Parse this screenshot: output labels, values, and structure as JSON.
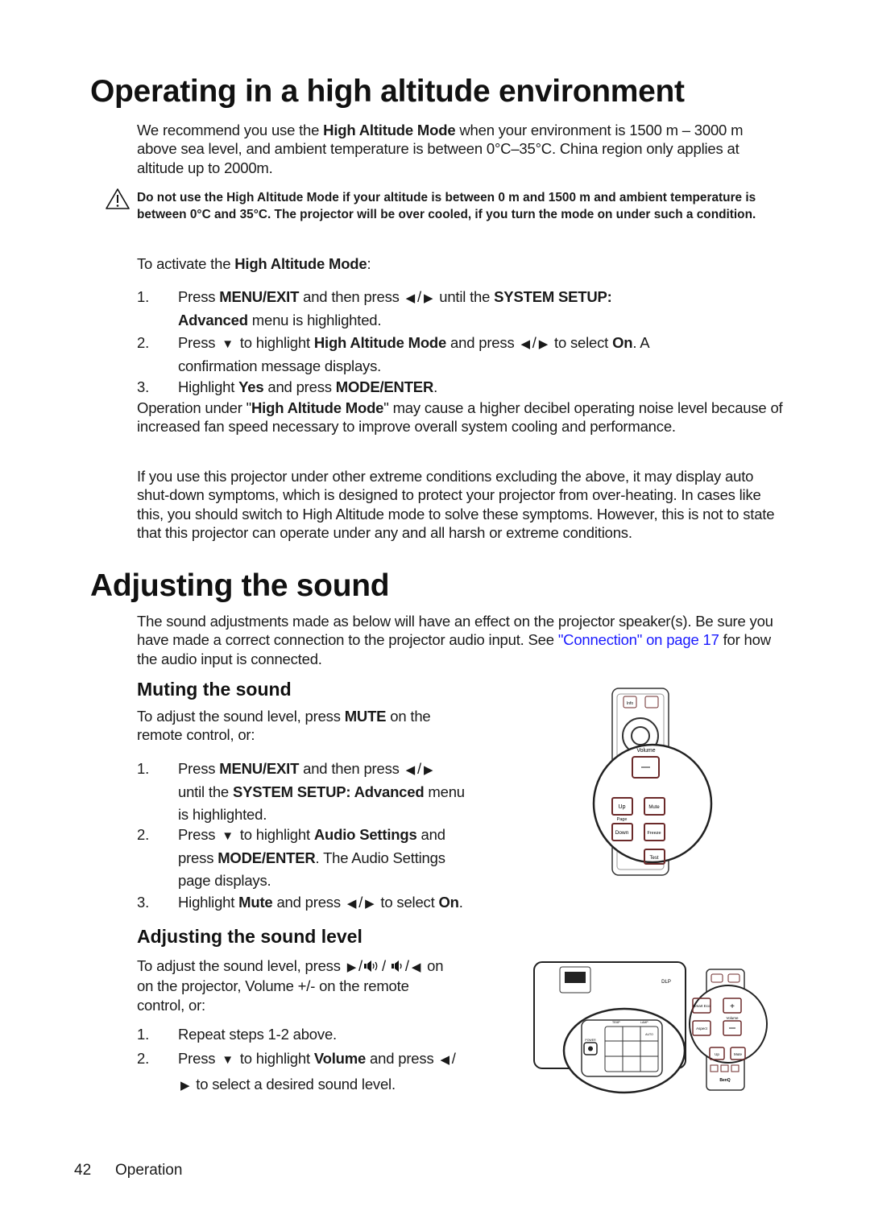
{
  "section1": {
    "title": "Operating in a high altitude environment",
    "intro": [
      {
        "t": "We recommend you use the "
      },
      {
        "t": "High Altitude Mode",
        "b": true
      },
      {
        "t": " when your environment is 1500 m – 3000 m above sea level, and ambient temperature is between 0°C–35°C. China region only applies at altitude up to 2000m."
      }
    ],
    "warning_icon": "warning-triangle-icon",
    "warning": "Do not use the High Altitude Mode if your altitude is between 0 m and 1500 m and ambient temperature is between 0°C and 35°C. The projector will be over cooled, if you turn the mode on under such a condition.",
    "activate": [
      {
        "t": "To activate the "
      },
      {
        "t": "High Altitude Mode",
        "b": true
      },
      {
        "t": ":"
      }
    ],
    "steps": [
      {
        "num": "1.",
        "text": [
          {
            "t": "Press "
          },
          {
            "t": "MENU/EXIT",
            "b": true
          },
          {
            "t": " and then press "
          },
          {
            "i": "left-arrow"
          },
          {
            "t": "/"
          },
          {
            "i": "right-arrow"
          },
          {
            "t": " until the "
          },
          {
            "t": "SYSTEM SETUP:",
            "b": true
          },
          {
            "br": true
          },
          {
            "t": "Advanced",
            "b": true
          },
          {
            "t": " menu is highlighted."
          }
        ]
      },
      {
        "num": "2.",
        "text": [
          {
            "t": "Press "
          },
          {
            "i": "down-arrow"
          },
          {
            "t": " to highlight "
          },
          {
            "t": "High Altitude Mode",
            "b": true
          },
          {
            "t": " and press "
          },
          {
            "i": "left-arrow"
          },
          {
            "t": "/"
          },
          {
            "i": "right-arrow"
          },
          {
            "t": " to select "
          },
          {
            "t": "On",
            "b": true
          },
          {
            "t": ". A"
          },
          {
            "br": true
          },
          {
            "t": "confirmation message displays."
          }
        ]
      },
      {
        "num": "3.",
        "text": [
          {
            "t": "Highlight "
          },
          {
            "t": "Yes",
            "b": true
          },
          {
            "t": " and press "
          },
          {
            "t": "MODE/ENTER",
            "b": true
          },
          {
            "t": "."
          }
        ]
      }
    ],
    "note1": [
      {
        "t": "Operation under \""
      },
      {
        "t": "High Altitude Mode",
        "b": true
      },
      {
        "t": "\" may cause a higher decibel operating noise level because of increased fan speed necessary to improve overall system cooling and performance."
      }
    ],
    "note2": [
      {
        "t": "If you use this projector under other extreme conditions excluding the above, it may display auto shut-down symptoms, which is designed to protect your projector from over-heating. In cases like this, you should switch to High Altitude mode to solve these symptoms. However, this is not to state that this projector can operate under any and all harsh or extreme conditions."
      }
    ]
  },
  "section2": {
    "title": "Adjusting the sound",
    "intro": [
      {
        "t": "The sound adjustments made as below will have an effect on the projector speaker(s). Be sure you have made a correct connection to the projector audio input. See "
      },
      {
        "t": "\"Connection\" on page 17",
        "link": true
      },
      {
        "t": " for how the audio input is connected."
      }
    ],
    "muting": {
      "title": "Muting the sound",
      "intro": [
        {
          "t": "To adjust the sound level, press "
        },
        {
          "t": "MUTE",
          "b": true
        },
        {
          "t": " on the"
        },
        {
          "br": true
        },
        {
          "t": "remote control, or:"
        }
      ],
      "steps": [
        {
          "num": "1.",
          "text": [
            {
              "t": "Press "
            },
            {
              "t": "MENU/EXIT",
              "b": true
            },
            {
              "t": " and then press "
            },
            {
              "i": "left-arrow"
            },
            {
              "t": "/"
            },
            {
              "i": "right-arrow"
            },
            {
              "br": true
            },
            {
              "t": "until the "
            },
            {
              "t": "SYSTEM SETUP: Advanced",
              "b": true
            },
            {
              "t": " menu"
            },
            {
              "br": true
            },
            {
              "t": "is highlighted."
            }
          ]
        },
        {
          "num": "2.",
          "text": [
            {
              "t": "Press "
            },
            {
              "i": "down-arrow"
            },
            {
              "t": " to highlight "
            },
            {
              "t": "Audio Settings",
              "b": true
            },
            {
              "t": " and"
            },
            {
              "br": true
            },
            {
              "t": "press "
            },
            {
              "t": "MODE/ENTER",
              "b": true
            },
            {
              "t": ". The Audio Settings"
            },
            {
              "br": true
            },
            {
              "t": "page displays."
            }
          ]
        },
        {
          "num": "3.",
          "text": [
            {
              "t": "Highlight "
            },
            {
              "t": "Mute",
              "b": true
            },
            {
              "t": " and press "
            },
            {
              "i": "left-arrow"
            },
            {
              "t": "/"
            },
            {
              "i": "right-arrow"
            },
            {
              "t": " to select "
            },
            {
              "t": "On",
              "b": true
            },
            {
              "t": "."
            }
          ]
        }
      ],
      "remote_labels": {
        "info": "Info",
        "volume": "Volume",
        "up": "Up",
        "mute": "Mute",
        "page": "Page",
        "down": "Down",
        "freeze": "Freeze",
        "test": "Test"
      }
    },
    "level": {
      "title": "Adjusting the sound level",
      "intro": [
        {
          "t": "To adjust the sound level, press "
        },
        {
          "i": "right-arrow"
        },
        {
          "t": "/"
        },
        {
          "i": "speaker-loud"
        },
        {
          "t": "/ "
        },
        {
          "i": "speaker-soft"
        },
        {
          "t": "/"
        },
        {
          "i": "left-arrow"
        },
        {
          "t": " on"
        },
        {
          "br": true
        },
        {
          "t": "on the projector,  Volume +/- on the remote"
        },
        {
          "br": true
        },
        {
          "t": "control, or:"
        }
      ],
      "steps": [
        {
          "num": "1.",
          "text": [
            {
              "t": "Repeat steps 1-2 above."
            }
          ]
        },
        {
          "num": "2.",
          "text": [
            {
              "t": "Press "
            },
            {
              "i": "down-arrow"
            },
            {
              "t": " to highlight "
            },
            {
              "t": "Volume",
              "b": true
            },
            {
              "t": " and press "
            },
            {
              "i": "left-arrow"
            },
            {
              "t": "/"
            },
            {
              "br": true
            },
            {
              "i": "right-arrow"
            },
            {
              "t": " to select a desired sound level."
            }
          ]
        }
      ],
      "remote_labels": {
        "smart_eco": "Smart Eco",
        "aspect": "Aspect",
        "volume": "Volume",
        "up": "Up",
        "mute": "Mute",
        "brand": "BenQ"
      },
      "projector_labels": {
        "power": "POWER",
        "temp": "TEMP",
        "lamp": "LAMP",
        "auto": "AUTO",
        "brand": "DLP"
      }
    }
  },
  "footer": {
    "page_number": "42",
    "section": "Operation"
  }
}
